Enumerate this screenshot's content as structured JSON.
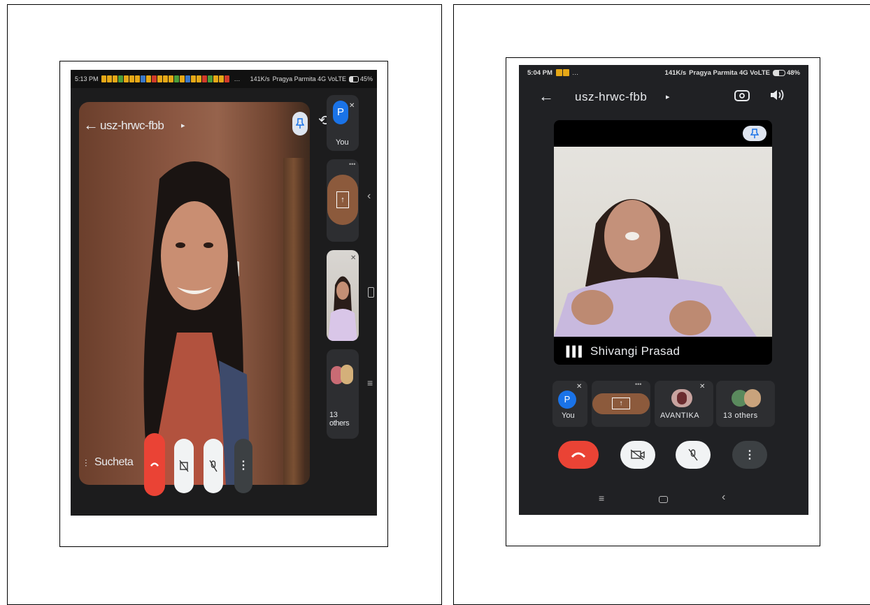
{
  "left_phone": {
    "status_bar": {
      "time": "5:13 PM",
      "speed": "141K/s",
      "carrier": "Pragya Parmita 4G VoLTE",
      "battery": "45%"
    },
    "meeting_code": "usz-hrwc-fbb",
    "speaker_name": "Sucheta",
    "tiles": [
      {
        "label": "You",
        "initial": "P"
      },
      {
        "label": ""
      },
      {
        "label": ""
      },
      {
        "label": "13 others"
      }
    ]
  },
  "right_phone": {
    "status_bar": {
      "time": "5:04 PM",
      "speed": "141K/s",
      "carrier": "Pragya Parmita 4G VoLTE",
      "battery": "48%"
    },
    "meeting_code": "usz-hrwc-fbb",
    "pinned_name": "Shivangi Prasad",
    "tiles": [
      {
        "label": "You",
        "initial": "P"
      },
      {
        "label": ""
      },
      {
        "label": "AVANTIKA"
      },
      {
        "label": "13 others"
      }
    ]
  },
  "colors": {
    "end_call": "#ea4335",
    "avatar_blue": "#1a73e8",
    "screen_bg": "#1c1c1d",
    "tile_bg": "#2d2e31"
  },
  "icons": [
    "back-arrow-icon",
    "pin-icon",
    "switch-camera-icon",
    "speaker-icon",
    "mic-off-icon",
    "camera-off-icon",
    "end-call-icon",
    "more-icon",
    "present-icon",
    "menu-nav-icon",
    "home-nav-icon",
    "back-nav-icon"
  ]
}
